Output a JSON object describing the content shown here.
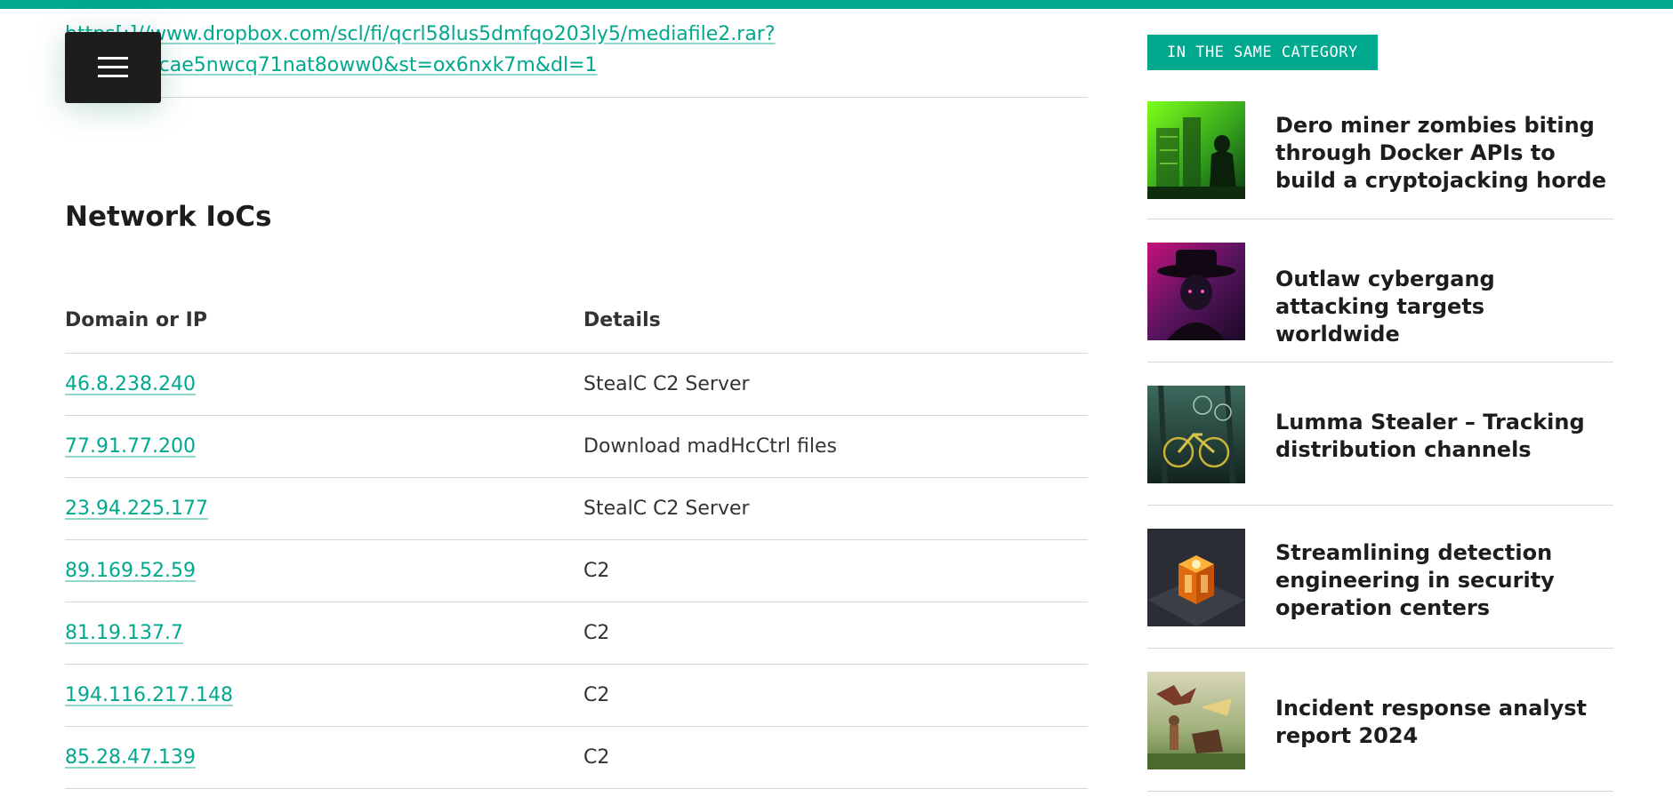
{
  "colors": {
    "accent": "#00a88e",
    "text": "#1d1d1b",
    "rule": "#d6d6d6"
  },
  "article": {
    "url_line_1": "https[:]//www.dropbox.com/scl/fi/qcrl58lus5dmfqo203ly5/mediafile2.rar?",
    "url_line_2": "rlkey=glacae5nwcq71nat8oww0&st=ox6nxk7m&dl=1",
    "menu_icon": "hamburger-menu-icon",
    "section_title": "Network IoCs",
    "table": {
      "headers": [
        "Domain or IP",
        "Details"
      ],
      "rows": [
        {
          "domain": "46.8.238.240",
          "details": "StealC C2 Server"
        },
        {
          "domain": "77.91.77.200",
          "details": "Download madHcCtrl files"
        },
        {
          "domain": "23.94.225.177",
          "details": "StealC C2 Server"
        },
        {
          "domain": "89.169.52.59",
          "details": "C2"
        },
        {
          "domain": "81.19.137.7",
          "details": "C2"
        },
        {
          "domain": "194.116.217.148",
          "details": "C2"
        },
        {
          "domain": "85.28.47.139",
          "details": "C2"
        }
      ]
    }
  },
  "sidebar": {
    "category_label": "IN THE SAME CATEGORY",
    "items": [
      {
        "title": "Dero miner zombies biting through Docker APIs to build a cryptojacking horde",
        "thumb": "green-zombie-city-thumbnail"
      },
      {
        "title": "Outlaw cybergang attacking targets worldwide",
        "thumb": "outlaw-hat-figure-thumbnail"
      },
      {
        "title": "Lumma Stealer – Tracking distribution channels",
        "thumb": "bicycles-forest-thumbnail"
      },
      {
        "title": "Streamlining detection engineering in security operation centers",
        "thumb": "glowing-cube-thumbnail"
      },
      {
        "title": "Incident response analyst report 2024",
        "thumb": "dragon-knight-thumbnail"
      }
    ]
  }
}
